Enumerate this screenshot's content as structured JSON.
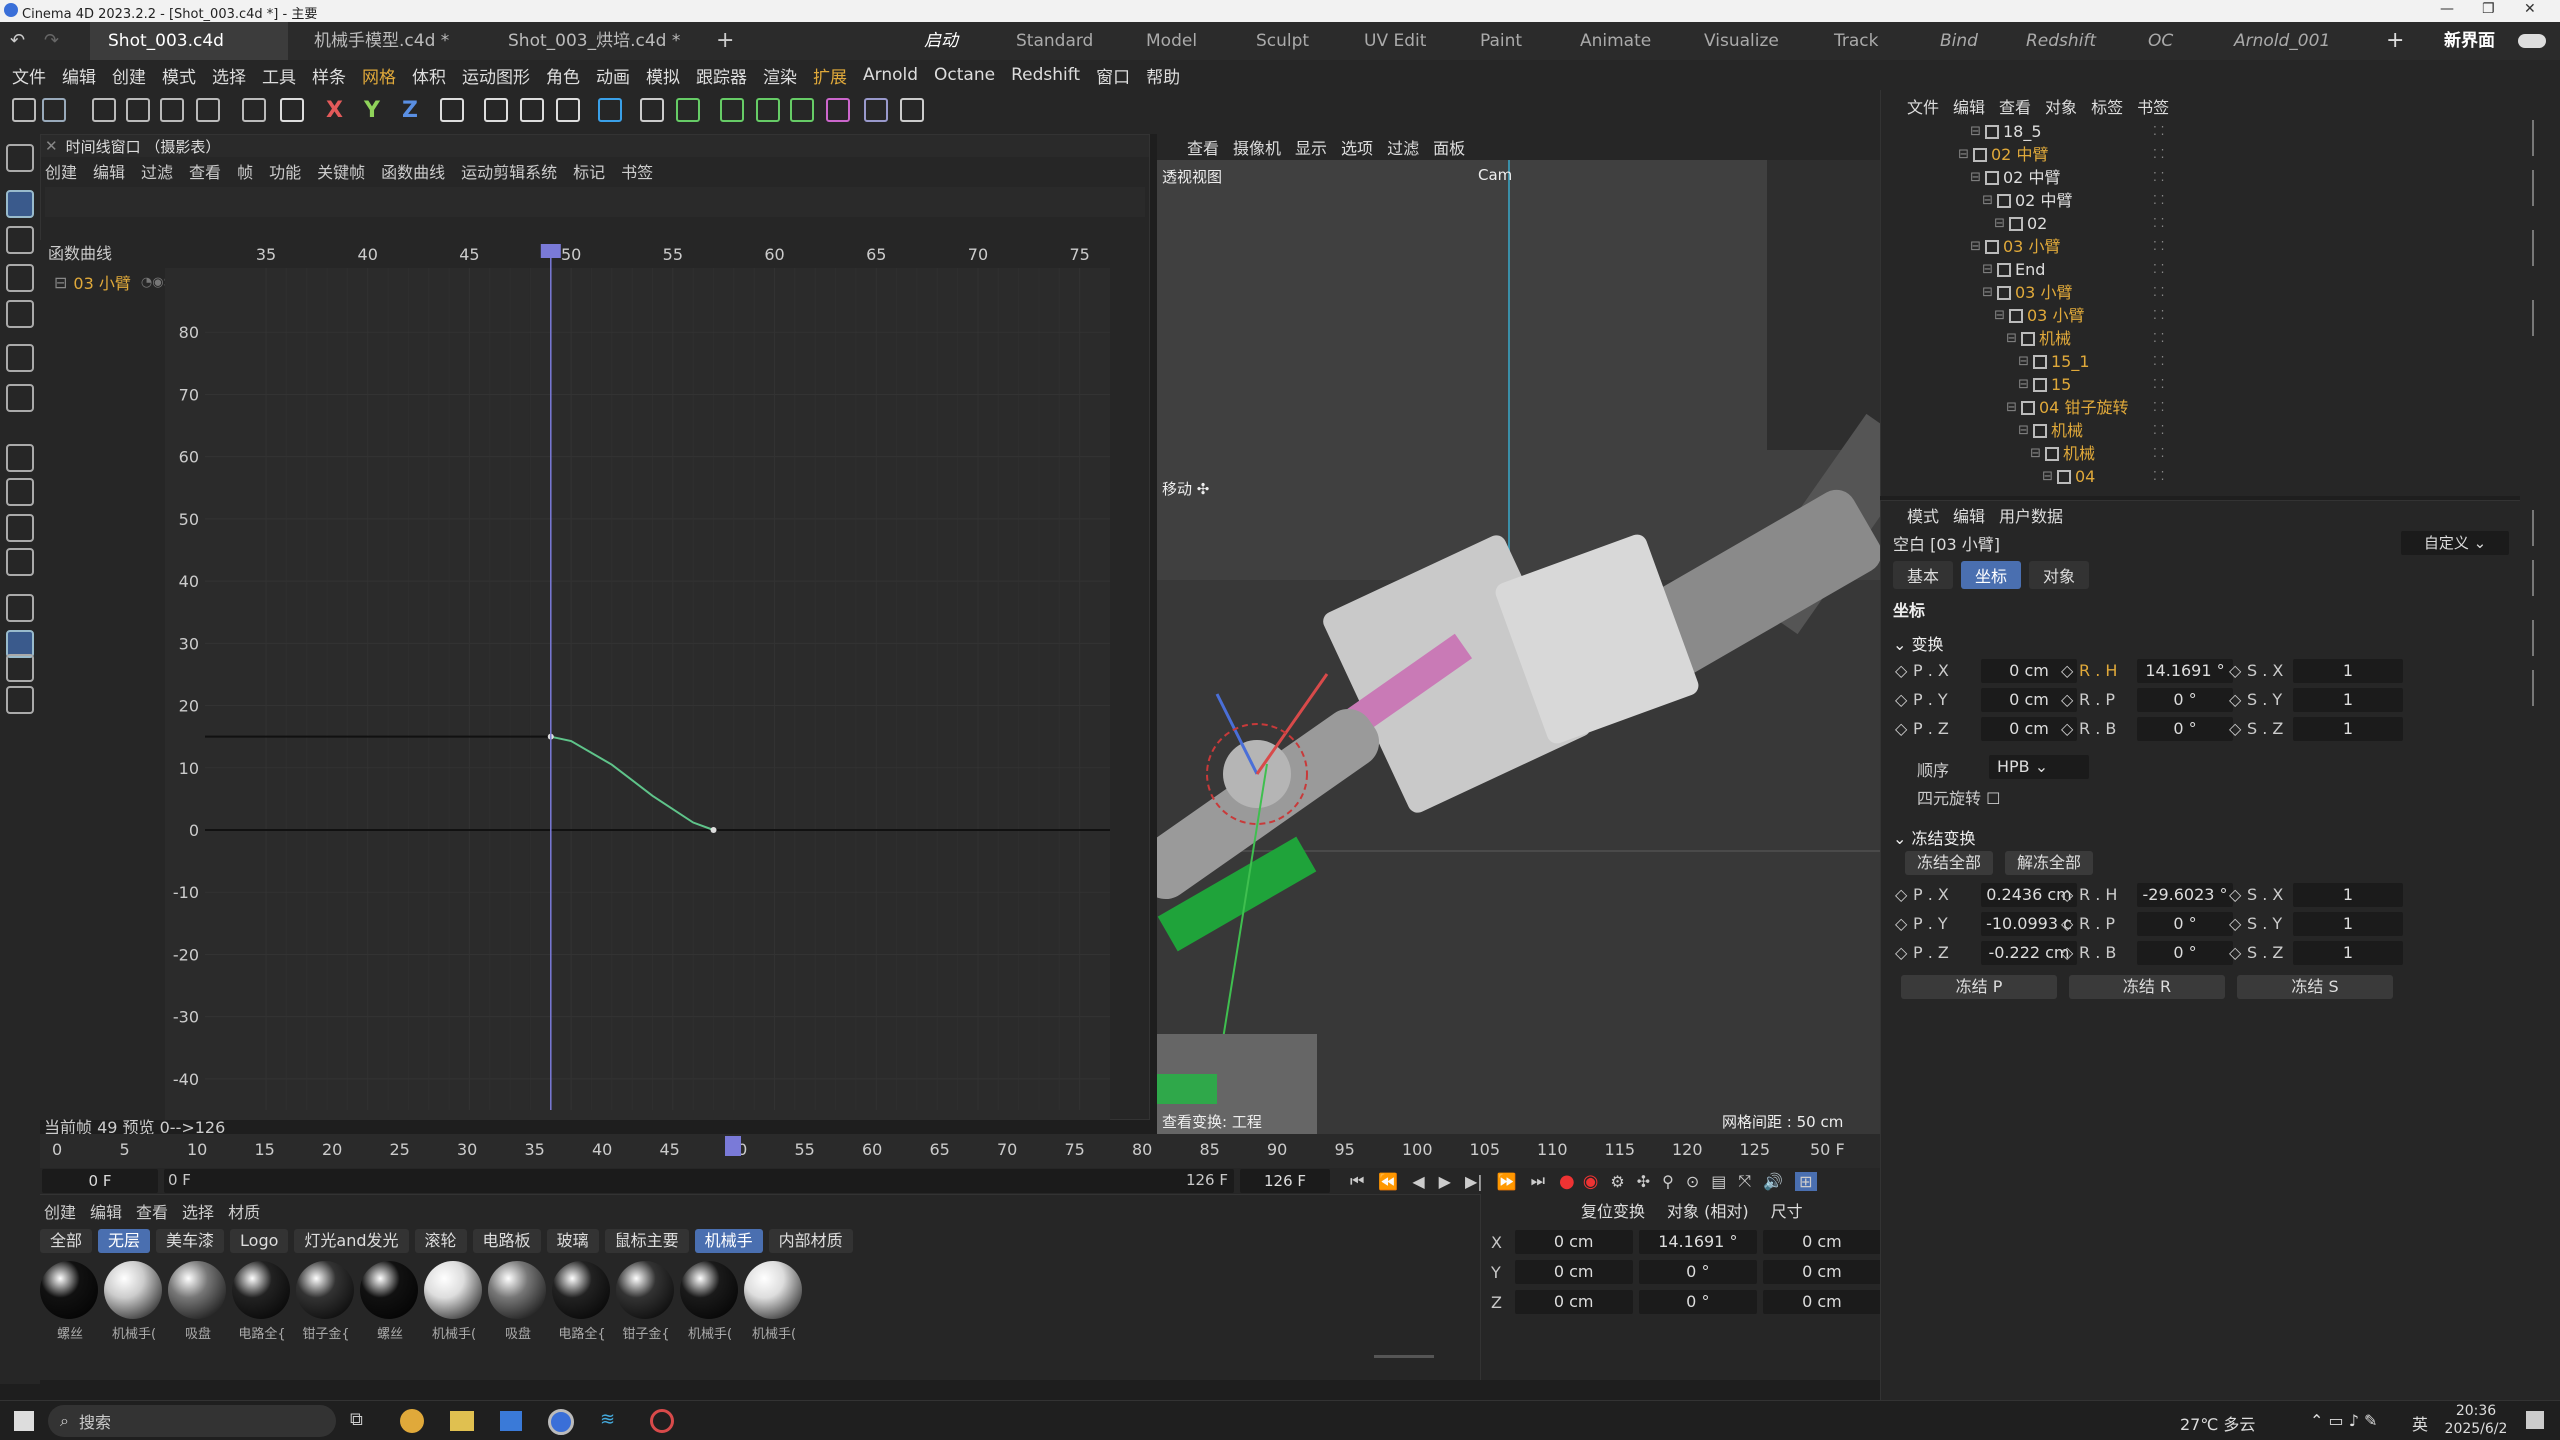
{
  "titlebar": {
    "title": "Cinema 4D 2023.2.2 - [Shot_003.c4d *] - 主要"
  },
  "tabs": [
    {
      "label": "Shot_003.c4d *"
    },
    {
      "label": "机械手模型.c4d *"
    },
    {
      "label": "Shot_003_烘培.c4d *"
    }
  ],
  "layouts": [
    "启动",
    "Standard",
    "Model",
    "Sculpt",
    "UV Edit",
    "Paint",
    "Animate",
    "Visualize",
    "Track",
    "Bind",
    "Redshift",
    "OC",
    "Arnold_001"
  ],
  "new_layout": "新界面",
  "menu": [
    "文件",
    "编辑",
    "创建",
    "模式",
    "选择",
    "工具",
    "样条",
    "网格",
    "体积",
    "运动图形",
    "角色",
    "动画",
    "模拟",
    "跟踪器",
    "渲染",
    "扩展",
    "Arnold",
    "Octane",
    "Redshift",
    "窗口",
    "帮助"
  ],
  "timeline": {
    "title": "时间线窗口 （摄影表）",
    "menu": [
      "创建",
      "编辑",
      "过滤",
      "查看",
      "帧",
      "功能",
      "关键帧",
      "函数曲线",
      "运动剪辑系统",
      "标记",
      "书签"
    ],
    "curve_label": "函数曲线",
    "track": "03 小臂",
    "x_ticks": [
      "35",
      "40",
      "45",
      "50",
      "55",
      "60",
      "65",
      "70",
      "75"
    ],
    "y_ticks": [
      "80",
      "70",
      "60",
      "50",
      "40",
      "30",
      "20",
      "10",
      "0",
      "-10",
      "-20",
      "-30",
      "-40"
    ],
    "current_frame": "当前帧  49  预览  0-->126"
  },
  "chart_data": {
    "type": "line",
    "series": [
      {
        "name": "03 小臂",
        "x": [
          49,
          50,
          52,
          54,
          56,
          57
        ],
        "y": [
          15,
          14.3,
          10.5,
          5.5,
          1.2,
          0
        ]
      }
    ],
    "xlim": [
      32,
      76
    ],
    "ylim": [
      -45,
      90
    ],
    "playhead": 49
  },
  "viewport": {
    "menu": [
      "查看",
      "摄像机",
      "显示",
      "选项",
      "过滤",
      "面板"
    ],
    "label": "透视视图",
    "camera": "Cam",
    "move": "移动",
    "grid": "网格间距 : 50 cm",
    "bottom": "查看变换: 工程"
  },
  "ruler": {
    "ticks": [
      "0",
      "5",
      "10",
      "15",
      "20",
      "25",
      "30",
      "35",
      "40",
      "45",
      "50",
      "55",
      "60",
      "65",
      "70",
      "75",
      "80",
      "85",
      "90",
      "95",
      "100",
      "105",
      "110",
      "115",
      "120",
      "125"
    ],
    "current": "50 F"
  },
  "frames": {
    "start": "0 F",
    "start2": "0 F",
    "end": "126 F",
    "end2": "126 F"
  },
  "materials": {
    "menu": [
      "创建",
      "编辑",
      "查看",
      "选择",
      "材质"
    ],
    "tabs": [
      "全部",
      "无层",
      "美车漆",
      "Logo",
      "灯光and发光",
      "滚轮",
      "电路板",
      "玻璃",
      "鼠标主要",
      "机械手",
      "内部材质"
    ],
    "active_tabs": [
      "无层",
      "机械手"
    ],
    "items": [
      "螺丝",
      "机械手(",
      "吸盘",
      "电路全{",
      "钳子金{",
      "螺丝",
      "机械手(",
      "吸盘",
      "电路全{",
      "钳子金{",
      "机械手(",
      "机械手("
    ]
  },
  "coords": {
    "header": [
      "复位变换",
      "对象 (相对)",
      "尺寸"
    ],
    "rows": [
      {
        "axis": "X",
        "pos": "0 cm",
        "rot": "14.1691 °",
        "size": "0 cm"
      },
      {
        "axis": "Y",
        "pos": "0 cm",
        "rot": "0 °",
        "size": "0 cm"
      },
      {
        "axis": "Z",
        "pos": "0 cm",
        "rot": "0 °",
        "size": "0 cm"
      }
    ]
  },
  "objmgr": {
    "menu": [
      "文件",
      "编辑",
      "查看",
      "对象",
      "标签",
      "书签"
    ],
    "rows": [
      {
        "label": "18_5",
        "color": "white",
        "indent": 5
      },
      {
        "label": "02 中臂",
        "color": "orange",
        "indent": 4
      },
      {
        "label": "02 中臂",
        "color": "white",
        "indent": 5
      },
      {
        "label": "02 中臂",
        "color": "white",
        "indent": 6
      },
      {
        "label": "02",
        "color": "white",
        "indent": 7
      },
      {
        "label": "03 小臂",
        "color": "orange",
        "indent": 5
      },
      {
        "label": "End",
        "color": "white",
        "indent": 6
      },
      {
        "label": "03 小臂",
        "color": "orange",
        "indent": 6
      },
      {
        "label": "03 小臂",
        "color": "orange",
        "indent": 7
      },
      {
        "label": "机械",
        "color": "orange",
        "indent": 8
      },
      {
        "label": "15_1",
        "color": "orange",
        "indent": 9
      },
      {
        "label": "15",
        "color": "orange",
        "indent": 9
      },
      {
        "label": "04 钳子旋转",
        "color": "orange",
        "indent": 8
      },
      {
        "label": "机械",
        "color": "orange",
        "indent": 9
      },
      {
        "label": "机械",
        "color": "orange",
        "indent": 10
      },
      {
        "label": "04",
        "color": "orange",
        "indent": 11
      }
    ]
  },
  "attr": {
    "menu": [
      "模式",
      "编辑",
      "用户数据"
    ],
    "object": "空白 [03 小臂]",
    "preset": "自定义",
    "tabs": [
      "基本",
      "坐标",
      "对象"
    ],
    "active_tab": "坐标",
    "section": "坐标",
    "transform": "变换",
    "fields": [
      {
        "p": "P . X",
        "pv": "0 cm",
        "r": "R . H",
        "rv": "14.1691 °",
        "s": "S . X",
        "sv": "1"
      },
      {
        "p": "P . Y",
        "pv": "0 cm",
        "r": "R . P",
        "rv": "0 °",
        "s": "S . Y",
        "sv": "1"
      },
      {
        "p": "P . Z",
        "pv": "0 cm",
        "r": "R . B",
        "rv": "0 °",
        "s": "S . Z",
        "sv": "1"
      }
    ],
    "order_label": "顺序",
    "order_value": "HPB",
    "quat": "四元旋转",
    "freeze": "冻结变换",
    "freeze_all": "冻结全部",
    "unfreeze_all": "解冻全部",
    "frozen": [
      {
        "p": "P . X",
        "pv": "0.2436 cm",
        "r": "R . H",
        "rv": "-29.6023 °",
        "s": "S . X",
        "sv": "1"
      },
      {
        "p": "P . Y",
        "pv": "-10.0993 c",
        "r": "R . P",
        "rv": "0 °",
        "s": "S . Y",
        "sv": "1"
      },
      {
        "p": "P . Z",
        "pv": "-0.222 cm",
        "r": "R . B",
        "rv": "0 °",
        "s": "S . Z",
        "sv": "1"
      }
    ],
    "freeze_buttons": [
      "冻结 P",
      "冻结 R",
      "冻结 S"
    ]
  },
  "taskbar": {
    "search": "搜索",
    "weather": "27℃ 多云",
    "ime": "英",
    "time": "20:36",
    "date": "2025/6/2"
  },
  "colors": {
    "accent": "#4a6fb0",
    "orange": "#e0a93a",
    "curve": "#5fc48a",
    "playhead": "#7a7ad8"
  }
}
